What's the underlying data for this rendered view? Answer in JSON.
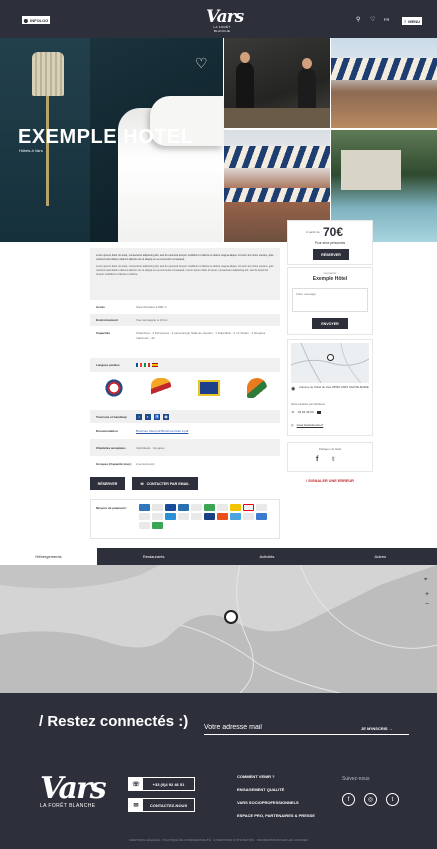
{
  "header": {
    "back_label": "INFOLOG",
    "logo_text": "Vars",
    "logo_subtitle": "LA FORÊT BLANCHE",
    "lang_label": "FR",
    "menu_label": "MENU"
  },
  "hero": {
    "title": "EXEMPLE HOTEL",
    "subtitle": "Hôtels à Vars"
  },
  "intro": {
    "paragraphs": [
      "Lorem ipsum dolor sit amet, consectetur adipiscing elit, sed do eiusmod tempor incididunt ut labore et dolore magna aliqua. Ut enim ad minim veniam, quis nostrud exercitation ullamco laboris nisi ut aliquip ex ea commodo consequat.",
      "Lorem ipsum dolor sit amet, consectetur adipiscing elit, sed do eiusmod tempor incididunt ut labore et dolore magna aliqua. Ut enim ad minim veniam, quis nostrud exercitation ullamco laboris nisi ut aliquip ex ea commodo consequat. Lorem ipsum dolor sit amet, consectetur adipiscing elit, sed do eiusmod tempor incididunt ut labore et dolore."
    ]
  },
  "details": {
    "rows": [
      {
        "label": "Accès",
        "value": "Gare Routière à 800 m"
      },
      {
        "label": "Environnement",
        "value": "Vue campagne à 10 km"
      },
      {
        "label": "Capacités",
        "value": "Chambres : 4   Personnes : 2 personne(s)   Salle de réunion : 1   Superficie : 4 m²   Suites : 1   Groupes maximum : 22"
      },
      {
        "label": "Langues parlées",
        "value": ""
      },
      {
        "label": "Tourisme et handicap",
        "value": ""
      },
      {
        "label": "Documentation",
        "value": "Brochure hôtel.pdf   Brochure hôtel 2.pdf"
      },
      {
        "label": "Clientèles acceptées",
        "value": "Individuels · Groupes"
      },
      {
        "label": "Groupes (Capacité max.)",
        "value": "2 personne(s)"
      }
    ]
  },
  "actions": {
    "reserve_label": "RÉSERVER",
    "contact_label": "CONTACTER PAR EMAIL"
  },
  "payment": {
    "label": "Moyens de paiement :"
  },
  "price": {
    "from_label": "À partir de",
    "amount": "70€",
    "note": "Pour deux personnes",
    "button": "RÉSERVER"
  },
  "contact_box": {
    "small_label": "Contacter",
    "name": "Exemple Hôtel",
    "message_placeholder": "Votre message",
    "send_label": "ENVOYER"
  },
  "location_box": {
    "address": "Adresse de l'hôtel de Vars 05560 VARS SAINTE-MARIE",
    "phone_label": "Nous contacter par téléphone",
    "phone": "04 92 46 00",
    "website": "www.hotelsitevars.fr"
  },
  "share_box": {
    "label": "Partager cet hôtel"
  },
  "report_error": "/ SIGNALER UNE ERREUR",
  "tabs": [
    "Hébergements",
    "Restaurants",
    "Activités",
    "Autres"
  ],
  "newsletter": {
    "title": "/ Restez connectés :)",
    "placeholder": "Votre adresse mail",
    "button": "JE M'INSCRIS →"
  },
  "footer": {
    "logo_text": "Vars",
    "logo_subtitle": "LA FORÊT BLANCHE",
    "phone": "+33 (0)4 92 46 51",
    "contact_label": "CONTACTEZ-NOUS",
    "links": [
      "COMMENT VENIR ?",
      "ENGAGEMENT QUALITÉ",
      "VARS SOCIOPROFESSIONNELS",
      "ESPACE PRO, PARTENAIRES & PRESSE"
    ],
    "social_label": "Suivez-nous",
    "legal": "MENTIONS LÉGALES · POLITIQUE DE CONFIDENTIALITÉ · CONDITIONS D'UTILISATION · INFORMATIONS SUR LES COOKIES"
  },
  "colors": {
    "dark": "#2d2f3a",
    "accent": "#c0282d"
  }
}
